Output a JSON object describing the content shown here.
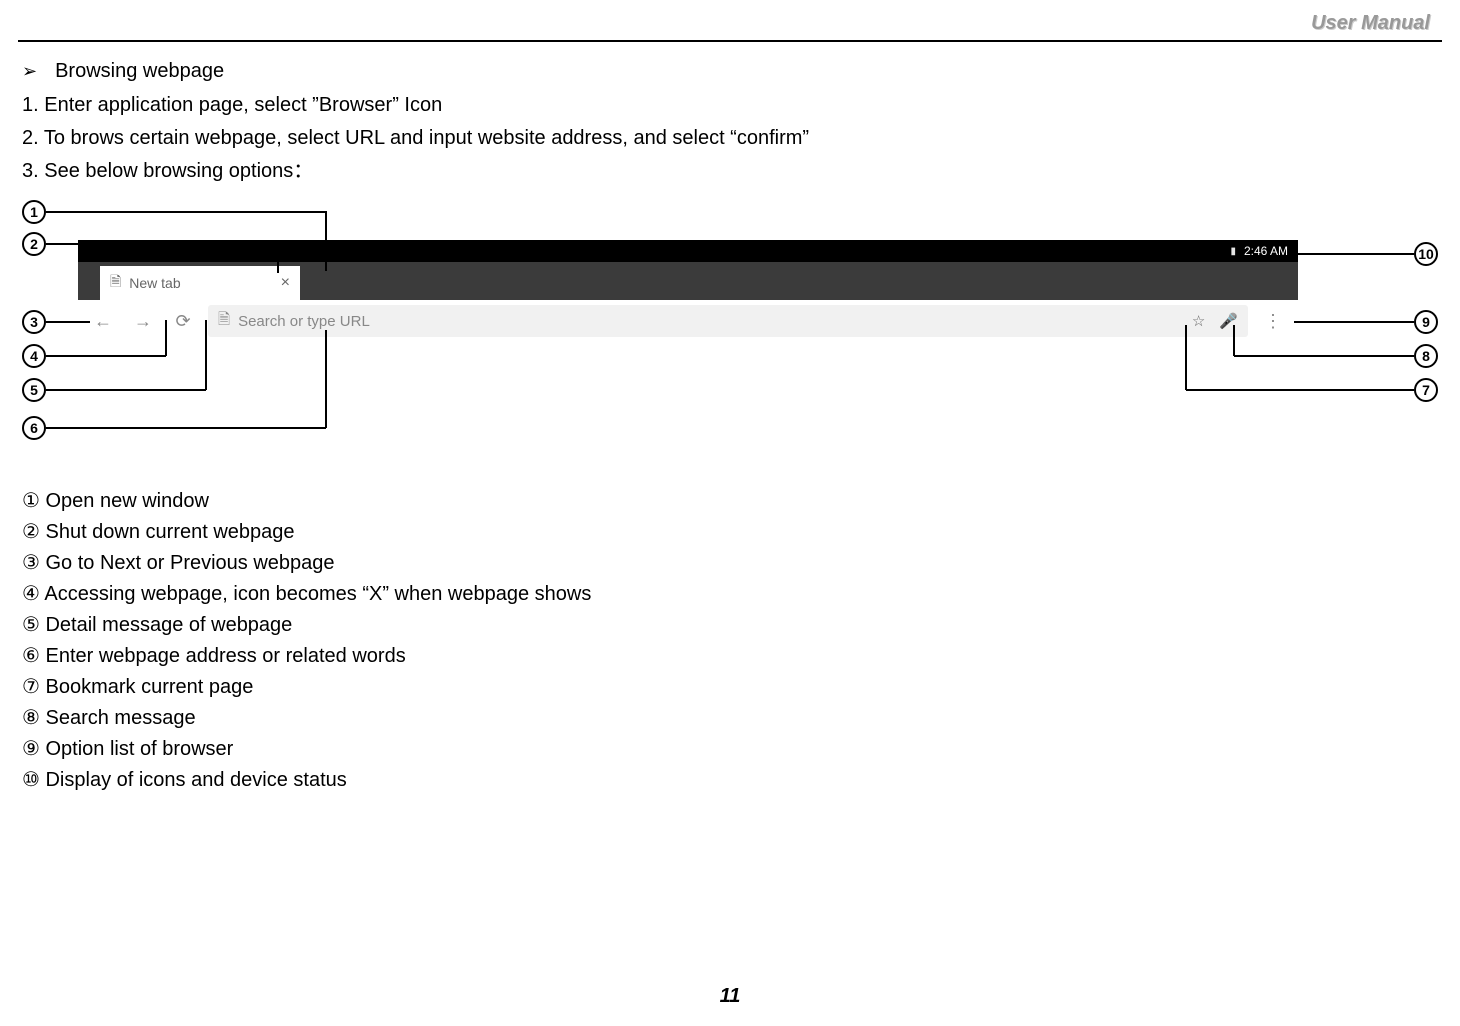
{
  "header": {
    "right_label": "User Manual"
  },
  "intro": {
    "bullet": "Browsing webpage",
    "steps": [
      "1. Enter application page, select ”Browser” Icon",
      "2. To brows certain webpage, select URL and input website address, and select “confirm”",
      "3. See below browsing options："
    ]
  },
  "screenshot": {
    "status_time": "2:46 AM",
    "tab_label": "New tab",
    "url_placeholder": "Search or type URL"
  },
  "callouts": {
    "left": [
      "1",
      "2",
      "3",
      "4",
      "5",
      "6"
    ],
    "right": [
      "10",
      "9",
      "8",
      "7"
    ]
  },
  "legend": [
    "① Open new window",
    "② Shut down current webpage",
    "③ Go to Next or Previous webpage",
    "④ Accessing webpage, icon becomes “X” when webpage shows",
    "⑤ Detail message of webpage",
    "⑥ Enter webpage address or related words",
    "⑦ Bookmark current page",
    "⑧ Search message",
    "⑨ Option list of browser",
    "⑩ Display of icons and device status"
  ],
  "page_number": "11"
}
